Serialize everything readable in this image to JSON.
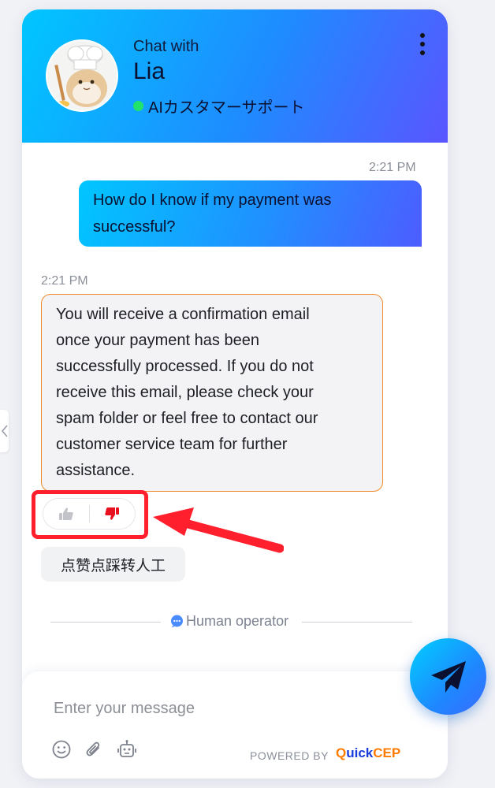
{
  "header": {
    "chat_with": "Chat with",
    "agent_name": "Lia",
    "agent_role": "AIカスタマーサポート",
    "status_color": "#22e36a"
  },
  "messages": [
    {
      "sender": "user",
      "time": "2:21 PM",
      "text_lines": [
        "How do I know if my payment was",
        "successful?"
      ]
    },
    {
      "sender": "bot",
      "time": "2:21 PM",
      "text_lines": [
        "You will receive a confirmation email",
        "once your payment has been",
        "successfully processed. If you do not",
        "receive this email, please check your",
        "spam folder or feel free to contact our",
        "customer service team for further",
        "assistance."
      ]
    }
  ],
  "quick_reply": "点赞点踩转人工",
  "divider_label": "Human operator",
  "composer": {
    "placeholder": "Enter your message",
    "powered_by": "POWERED BY",
    "brand_q": "Q",
    "brand_uick": "uick",
    "brand_cep": "CEP"
  },
  "colors": {
    "header_gradient": [
      "#00c6ff",
      "#1e8cff",
      "#5a55ff"
    ],
    "bot_bubble_border": "#f08a2c",
    "annotation_red": "#ff1f2d",
    "brand_orange": "#ff7a00",
    "brand_blue": "#1a3bdc"
  },
  "icons": [
    "more-vertical-icon",
    "thumbs-up-icon",
    "thumbs-down-icon",
    "chat-bubble-icon",
    "emoji-icon",
    "attachment-icon",
    "robot-icon",
    "send-icon",
    "chevron-left-icon"
  ]
}
